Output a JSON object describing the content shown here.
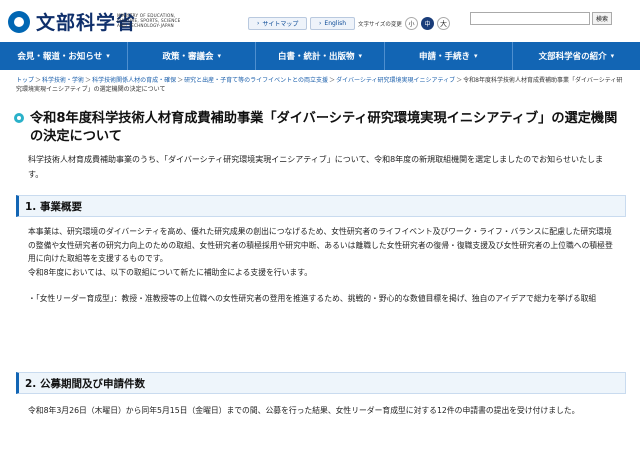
{
  "header": {
    "logo_text": "文部科学省",
    "logo_sub": "MINISTRY OF EDUCATION, CULTURE, SPORTS, SCIENCE AND TECHNOLOGY-JAPAN",
    "sitemap_label": "サイトマップ",
    "english_label": "English",
    "font_size_label": "文字サイズの変更",
    "font_small": "小",
    "font_medium": "中",
    "font_large": "大",
    "search_value": "",
    "search_button": "検索"
  },
  "nav": {
    "items": [
      {
        "label": "会見・報道・お知らせ"
      },
      {
        "label": "政策・審議会"
      },
      {
        "label": "白書・統計・出版物"
      },
      {
        "label": "申請・手続き"
      },
      {
        "label": "文部科学省の紹介"
      }
    ]
  },
  "breadcrumb": {
    "items": [
      "トップ",
      "科学技術・学術",
      "科学技術関係人材の育成・確保",
      "研究と出産・子育て等のライフイベントとの両立支援",
      "ダイバーシティ研究環境実現イニシアティブ"
    ],
    "current": "令和8年度科学技術人材育成費補助事業「ダイバーシティ研究環境実現イニシアティブ」の選定機関の決定について",
    "separator": "＞"
  },
  "page": {
    "title": "令和8年度科学技術人材育成費補助事業「ダイバーシティ研究環境実現イニシアティブ」の選定機関の決定について",
    "intro": "科学技術人材育成費補助事業のうち、「ダイバーシティ研究環境実現イニシアティブ」について、令和8年度の新規取組機関を選定しましたのでお知らせいたします。"
  },
  "section1": {
    "heading": "1. 事業概要",
    "para1": "本事業は、研究環境のダイバーシティを高め、優れた研究成果の創出につなげるため、女性研究者のライフイベント及びワーク・ライフ・バランスに配慮した研究環境の整備や女性研究者の研究力向上のための取組、女性研究者の積極採用や研究中断、あるいは離職した女性研究者の復帰・復職支援及び女性研究者の上位職への積極登用に向けた取組等を支援するものです。",
    "para2": "令和8年度においては、以下の取組について新たに補助金による支援を行います。",
    "para3": "・「女性リーダー育成型」：教授・准教授等の上位職への女性研究者の登用を推進するため、挑戦的・野心的な数値目標を掲げ、独自のアイデアで総力を挙げる取組"
  },
  "section2": {
    "heading": "2. 公募期間及び申請件数",
    "para1": "令和8年3月26日（木曜日）から同年5月15日（金曜日）までの間、公募を行った結果、女性リーダー育成型に対する12件の申請書の提出を受け付けました。"
  }
}
